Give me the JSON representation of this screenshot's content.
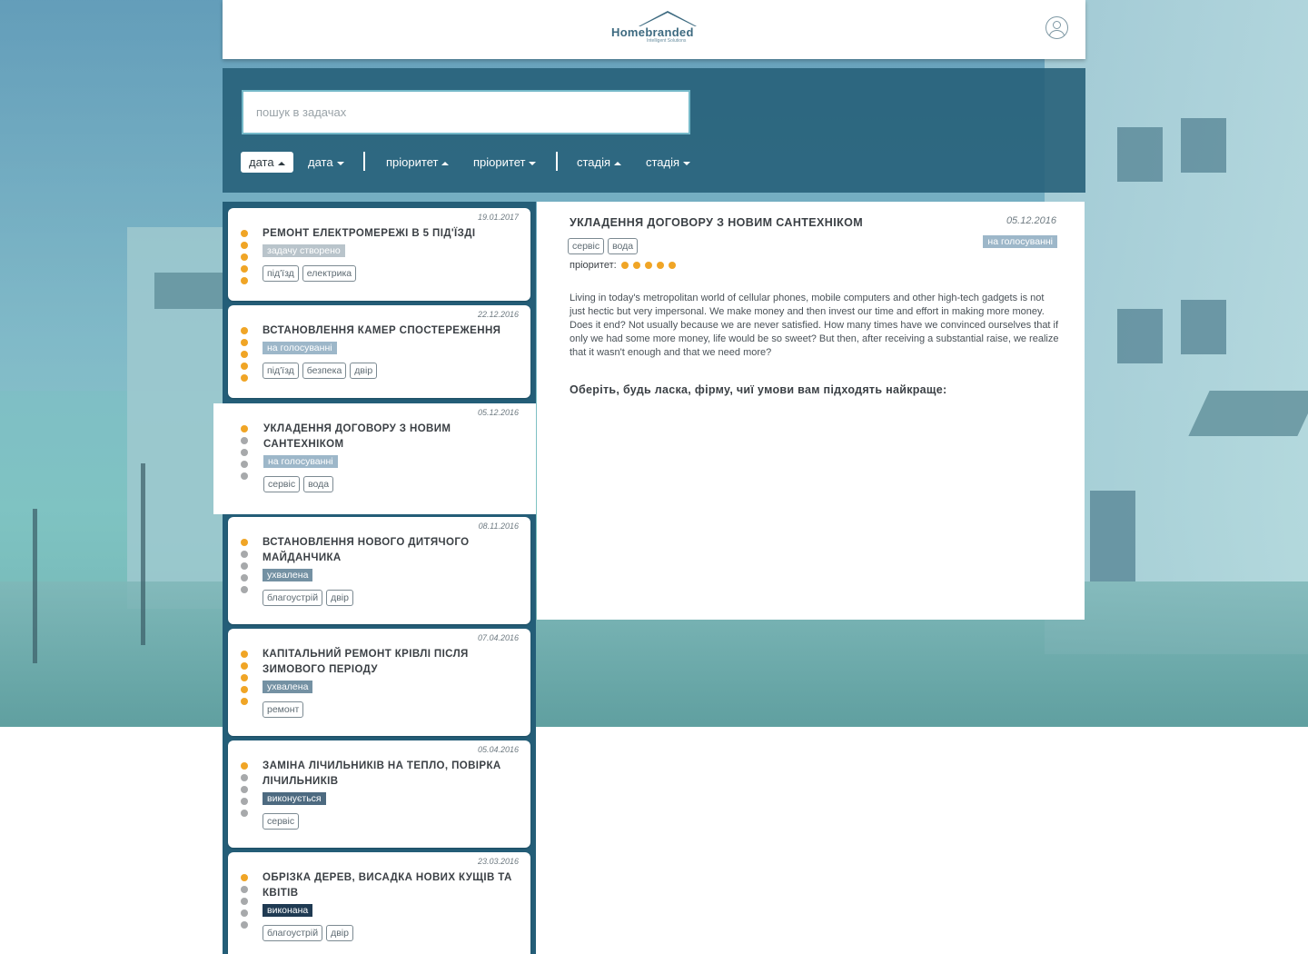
{
  "header": {
    "logo_text": "Homebranded",
    "logo_sub": "Intelligent Solutions",
    "user_icon": "user-icon"
  },
  "search": {
    "placeholder": "пошук в задачах"
  },
  "sort": [
    {
      "label": "дата",
      "dir": "up",
      "active": true
    },
    {
      "label": "дата",
      "dir": "down",
      "active": false
    },
    {
      "label": "пріоритет",
      "dir": "up",
      "active": false
    },
    {
      "label": "пріоритет",
      "dir": "down",
      "active": false
    },
    {
      "label": "стадія",
      "dir": "up",
      "active": false
    },
    {
      "label": "стадія",
      "dir": "down",
      "active": false
    }
  ],
  "colors": {
    "accent": "#f0a526",
    "panel": "#245e78",
    "dot_off": "#a7a9ab"
  },
  "tasks": [
    {
      "date": "19.01.2017",
      "title": "Ремонт електромережі в 5 під'їзді",
      "priority": 5,
      "status": "задачу створено",
      "tags": [
        "під'їзд",
        "електрика"
      ]
    },
    {
      "date": "22.12.2016",
      "title": "Встановлення камер спостереження",
      "priority": 5,
      "status": "на голосуванні",
      "tags": [
        "під'їзд",
        "безпека",
        "двір"
      ]
    },
    {
      "date": "05.12.2016",
      "title": "Укладення договору з новим сантехніком",
      "priority": 1,
      "status": "на голосуванні",
      "tags": [
        "сервіс",
        "вода"
      ]
    },
    {
      "date": "08.11.2016",
      "title": "Встановлення нового дитячого майданчика",
      "priority": 1,
      "status": "ухвалена",
      "tags": [
        "благоустрій",
        "двір"
      ]
    },
    {
      "date": "07.04.2016",
      "title": "Капітальний ремонт крівлі після зимового періоду",
      "priority": 5,
      "status": "ухвалена",
      "tags": [
        "ремонт"
      ]
    },
    {
      "date": "05.04.2016",
      "title": "Заміна лічильників на тепло, повірка лічильників",
      "priority": 1,
      "status": "виконується",
      "tags": [
        "сервіс"
      ]
    },
    {
      "date": "23.03.2016",
      "title": "Обрізка дерев, висадка нових кущів та квітів",
      "priority": 1,
      "status": "виконана",
      "tags": [
        "благоустрій",
        "двір"
      ]
    }
  ],
  "detail": {
    "title": "Укладення договору з новим сантехніком",
    "date": "05.12.2016",
    "status": "на голосуванні",
    "tags": [
      "сервіс",
      "вода"
    ],
    "priority_label": "пріоритет:",
    "priority": 5,
    "text": "Living in today's metropolitan world of cellular phones, mobile computers and other high-tech gadgets is not just hectic but very impersonal. We make money and then invest our time and effort in making more money. Does it end? Not usually because we are never satisfied. How many times have we convinced ourselves that if only we had some more money, life would be so sweet? But then, after receiving a substantial raise, we realize that it wasn't enough and that we need more?",
    "question": "Оберіть, будь ласка, фірму, чиї умови вам підходять найкраще:"
  }
}
